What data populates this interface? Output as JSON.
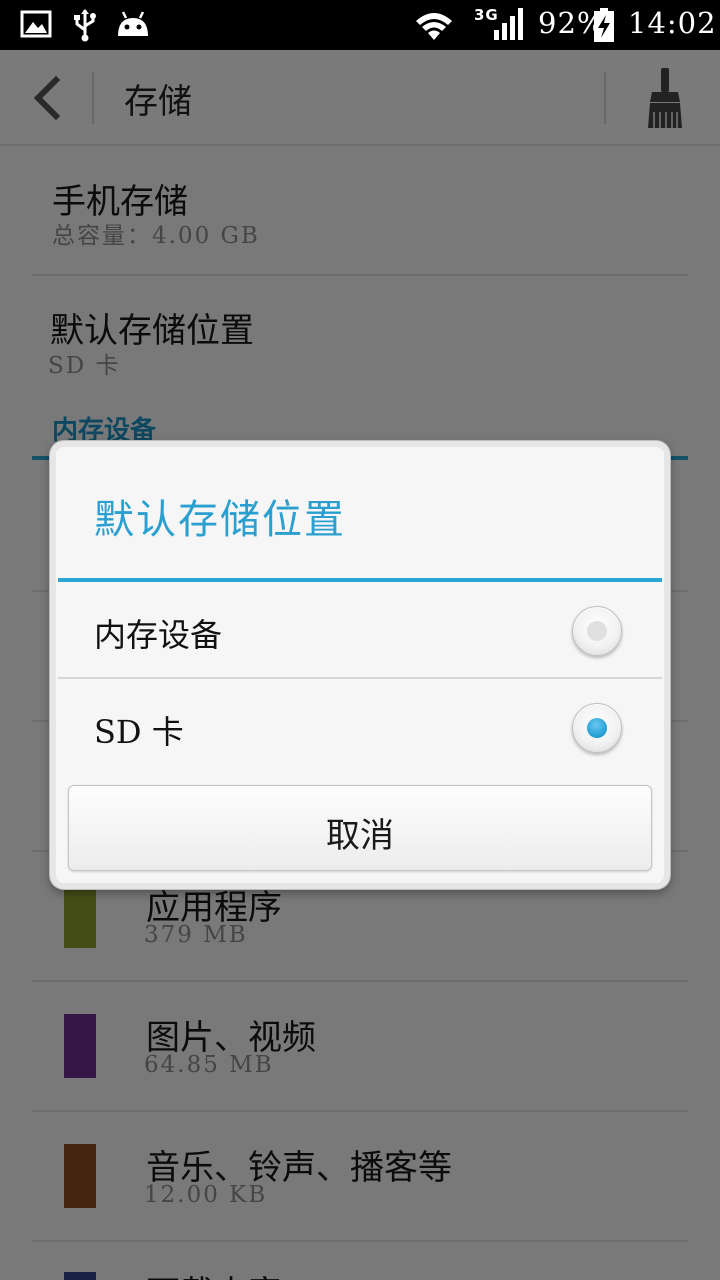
{
  "status_bar": {
    "network": "3G",
    "battery": "92%",
    "time": "14:02",
    "icons": [
      "gallery-icon",
      "usb-icon",
      "android-icon",
      "wifi-icon",
      "signal-icon",
      "battery-charging-icon"
    ]
  },
  "action_bar": {
    "title": "存储",
    "back_icon": "back-arrow-icon",
    "clean_icon": "broom-icon"
  },
  "list": {
    "phone_storage": {
      "title": "手机存储",
      "subtitle": "总容量：4.00  GB"
    },
    "default_location": {
      "title": "默认存储位置",
      "subtitle": "SD 卡"
    },
    "section_header": "内存设备",
    "items": [
      {
        "label": "应用程序",
        "size": "379 MB",
        "color": "#8a9b2c"
      },
      {
        "label": "图片、视频",
        "size": "64.85 MB",
        "color": "#6b2c8c"
      },
      {
        "label": "音乐、铃声、播客等",
        "size": "12.00 KB",
        "color": "#8b4a22"
      },
      {
        "label": "下载内容",
        "size": "",
        "color": "#35448f"
      }
    ]
  },
  "dialog": {
    "title": "默认存储位置",
    "options": [
      {
        "label": "内存设备",
        "selected": false
      },
      {
        "label": "SD 卡",
        "selected": true
      }
    ],
    "cancel_label": "取消"
  },
  "colors": {
    "accent": "#2aa3cf",
    "overlay": "rgba(0,0,0,0.5)"
  }
}
